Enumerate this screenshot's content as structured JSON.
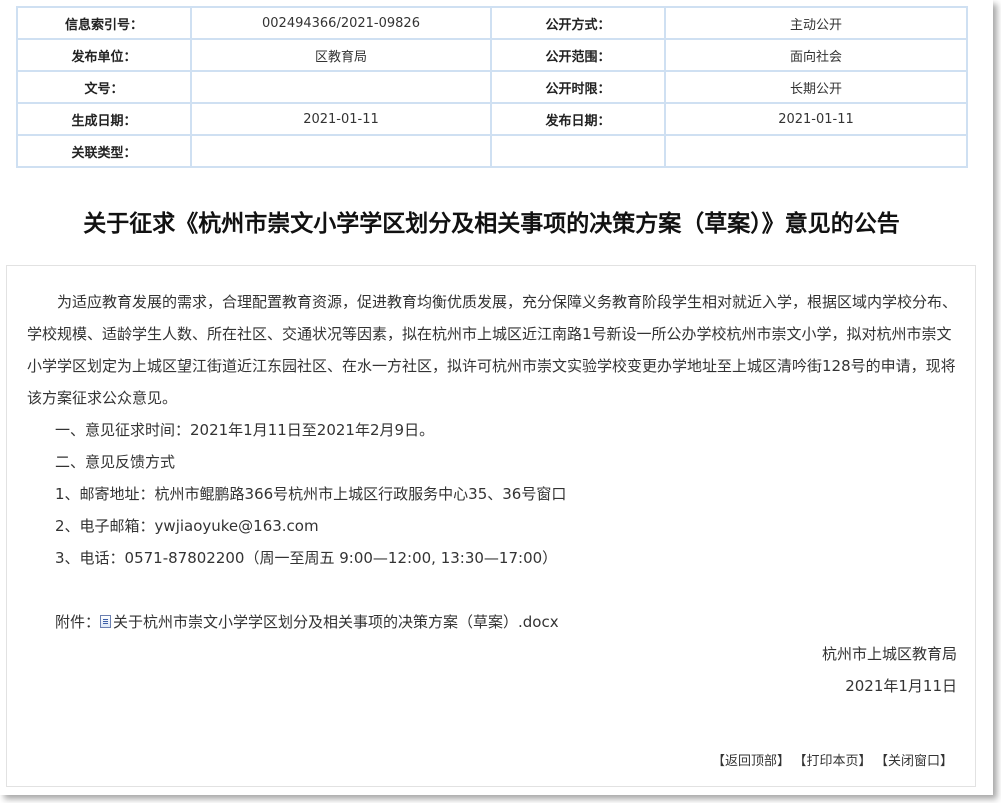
{
  "meta": {
    "rows": [
      [
        {
          "label": "信息索引号：",
          "value": "002494366/2021-09826"
        },
        {
          "label": "公开方式：",
          "value": "主动公开"
        }
      ],
      [
        {
          "label": "发布单位：",
          "value": "区教育局"
        },
        {
          "label": "公开范围：",
          "value": "面向社会"
        }
      ],
      [
        {
          "label": "文号：",
          "value": ""
        },
        {
          "label": "公开时限：",
          "value": "长期公开"
        }
      ],
      [
        {
          "label": "生成日期：",
          "value": "2021-01-11"
        },
        {
          "label": "发布日期：",
          "value": "2021-01-11"
        }
      ],
      [
        {
          "label": "关联类型：",
          "value": ""
        },
        {
          "label": "",
          "value": ""
        }
      ]
    ]
  },
  "article": {
    "title": "关于征求《杭州市崇文小学学区划分及相关事项的决策方案（草案）》意见的公告",
    "intro": "为适应教育发展的需求，合理配置教育资源，促进教育均衡优质发展，充分保障义务教育阶段学生相对就近入学，根据区域内学校分布、学校规模、适龄学生人数、所在社区、交通状况等因素，拟在杭州市上城区近江南路1号新设一所公办学校杭州市崇文小学，拟对杭州市崇文小学学区划定为上城区望江街道近江东园社区、在水一方社区，拟许可杭州市崇文实验学校变更办学地址至上城区清吟街128号的申请，现将该方案征求公众意见。",
    "item1": "一、意见征求时间：2021年1月11日至2021年2月9日。",
    "item2": "二、意见反馈方式",
    "item2_1": "1、邮寄地址：杭州市鲲鹏路366号杭州市上城区行政服务中心35、36号窗口",
    "item2_2": "2、电子邮箱：ywjiaoyuke@163.com",
    "item2_3": "3、电话：0571-87802200（周一至周五 9:00—12:00, 13:30—17:00）",
    "attachment_label": "附件：",
    "attachment_name": "关于杭州市崇文小学学区划分及相关事项的决策方案（草案）.docx",
    "signer": "杭州市上城区教育局",
    "date": "2021年1月11日"
  },
  "footer": {
    "back_top": "【返回顶部】",
    "print": "【打印本页】",
    "close": "【关闭窗口】"
  },
  "colors": {
    "table_border": "#cfe0f2",
    "box_border": "#e2e2e2"
  },
  "icons": {
    "attachment": "word-doc-icon"
  }
}
